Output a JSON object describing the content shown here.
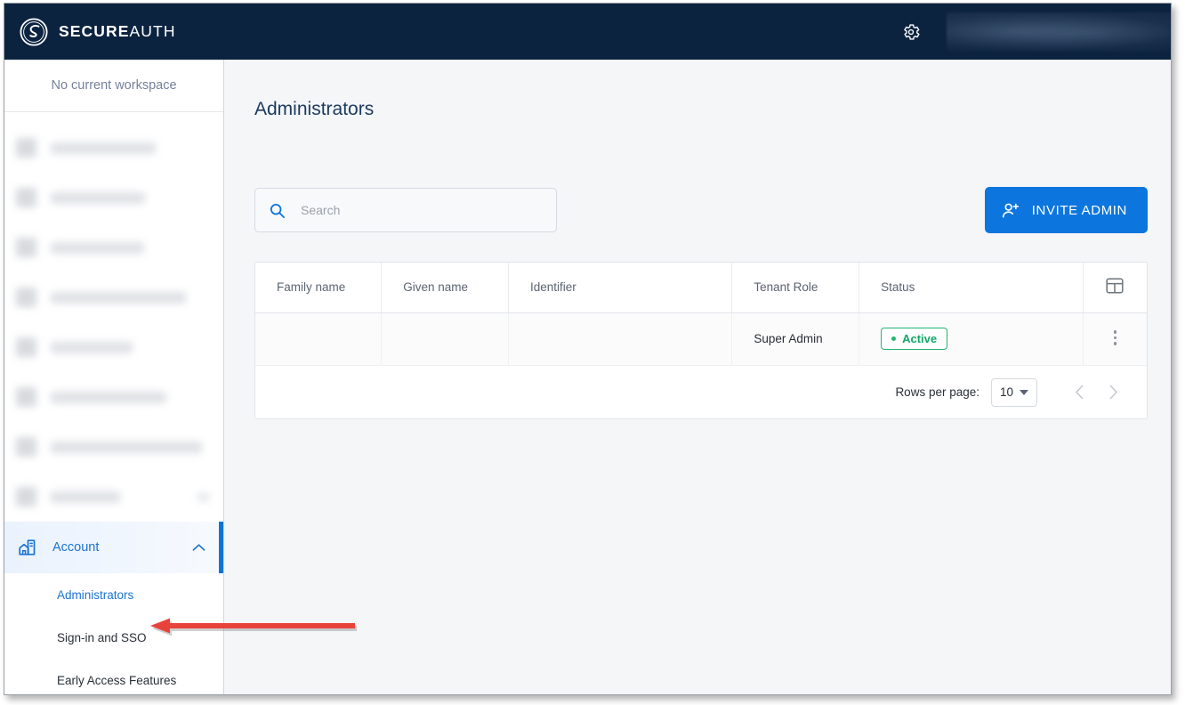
{
  "app": {
    "brand_bold": "SECURE",
    "brand_light": "AUTH",
    "logo_icon": "secureauth-circle-logo",
    "header_bg": "#0c2340",
    "accent": "#0c76de",
    "status_green": "#22b573"
  },
  "topbar": {
    "settings_icon": "gear-icon",
    "user_block_redacted": ""
  },
  "sidebar": {
    "workspace_label": "No current workspace",
    "redacted_items": [
      {
        "label_width": 118
      },
      {
        "label_width": 106
      },
      {
        "label_width": 105
      },
      {
        "label_width": 152
      },
      {
        "label_width": 92
      },
      {
        "label_width": 130
      },
      {
        "label_width": 170
      },
      {
        "label_width": 78,
        "has_chevron": true
      }
    ],
    "account": {
      "label": "Account",
      "icon": "account-building-icon",
      "chevron": "chevron-up-icon",
      "expanded": true,
      "items": [
        {
          "label": "Administrators",
          "active": true
        },
        {
          "label": "Sign-in and SSO",
          "active": false
        },
        {
          "label": "Early Access Features",
          "active": false
        }
      ]
    }
  },
  "main": {
    "title": "Administrators",
    "search": {
      "placeholder": "Search",
      "value": "",
      "icon": "search-icon"
    },
    "invite_button": {
      "label": "INVITE ADMIN",
      "icon": "person-add-icon"
    },
    "table": {
      "columns": [
        "Family name",
        "Given name",
        "Identifier",
        "Tenant Role",
        "Status"
      ],
      "settings_icon": "table-columns-icon",
      "rows": [
        {
          "family_name": "",
          "given_name": "",
          "identifier": "",
          "tenant_role": "Super Admin",
          "status": "Active",
          "row_menu_icon": "kebab-menu-icon"
        }
      ]
    },
    "pagination": {
      "rows_per_page_label": "Rows per page:",
      "rows_per_page_value": "10",
      "prev_icon": "chevron-left-icon",
      "next_icon": "chevron-right-icon"
    }
  },
  "annotation": {
    "arrow_color": "#e8433b",
    "points_to": "Sign-in and SSO"
  }
}
